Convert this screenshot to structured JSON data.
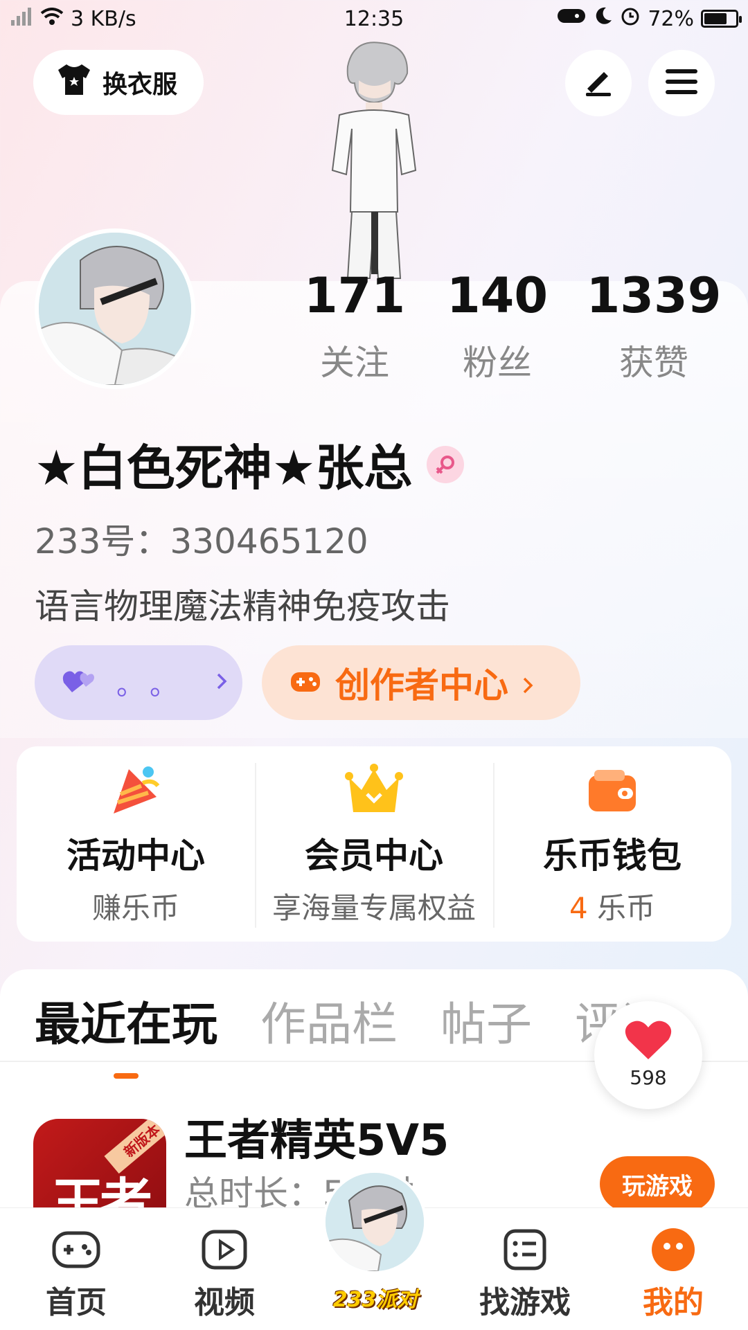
{
  "status_bar": {
    "speed": "3 KB/s",
    "time": "12:35",
    "battery": "72%",
    "battery_level": 0.72
  },
  "header": {
    "outfit_label": "换衣服",
    "edit_icon": "pen-icon",
    "menu_icon": "hamburger-menu-icon"
  },
  "profile": {
    "stats": [
      {
        "value": "171",
        "label": "关注"
      },
      {
        "value": "140",
        "label": "粉丝"
      },
      {
        "value": "1339",
        "label": "获赞"
      }
    ],
    "nickname": "★白色死神★张总",
    "uid": "233号：330465120",
    "bio": "语言物理魔法精神免疫攻击",
    "pill_purple_dots": "。。",
    "creator_center": "创作者中心"
  },
  "quick_actions": [
    {
      "title": "活动中心",
      "sub": "赚乐币",
      "icon": "party-popper-icon"
    },
    {
      "title": "会员中心",
      "sub": "享海量专属权益",
      "icon": "crown-icon"
    },
    {
      "title": "乐币钱包",
      "sub_num": "4",
      "sub": " 乐币",
      "icon": "wallet-icon"
    }
  ],
  "tabs": [
    "最近在玩",
    "作品栏",
    "帖子",
    "评论"
  ],
  "like_count": "598",
  "recent_game": {
    "name": "王者精英5V5",
    "time": "总时长：5小时",
    "badge": "新版本",
    "icon_text": "王者",
    "play_label": "玩游戏"
  },
  "bottom_nav": [
    {
      "label": "首页",
      "icon": "gamepad-icon"
    },
    {
      "label": "视频",
      "icon": "play-icon"
    },
    {
      "label": "233派对",
      "icon": "party-avatar"
    },
    {
      "label": "找游戏",
      "icon": "list-icon"
    },
    {
      "label": "我的",
      "icon": "me-icon"
    }
  ],
  "colors": {
    "accent": "#f86a12",
    "purple": "#7a60e6"
  }
}
